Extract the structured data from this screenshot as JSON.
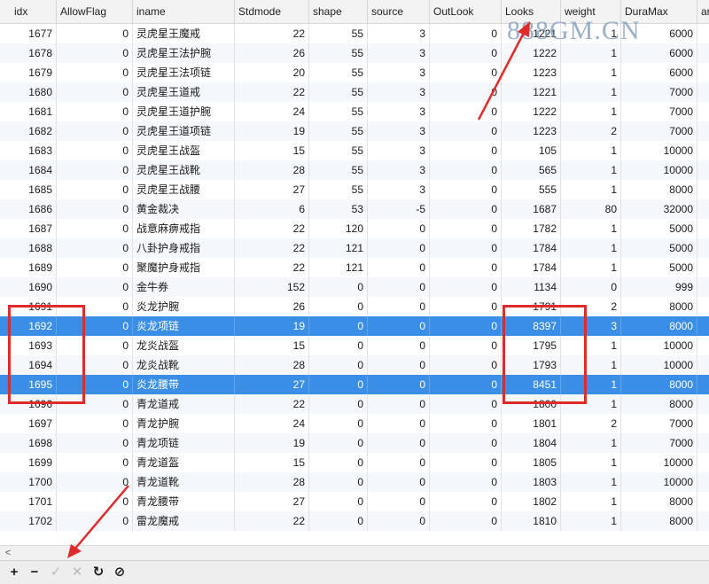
{
  "columns": [
    "idx",
    "AllowFlag",
    "iname",
    "Stdmode",
    "shape",
    "source",
    "OutLook",
    "Looks",
    "weight",
    "DuraMax",
    "ar"
  ],
  "rows": [
    [
      "1677",
      "0",
      "灵虎星王魔戒",
      "22",
      "55",
      "3",
      "0",
      "1221",
      "1",
      "6000"
    ],
    [
      "1678",
      "0",
      "灵虎星王法护腕",
      "26",
      "55",
      "3",
      "0",
      "1222",
      "1",
      "6000"
    ],
    [
      "1679",
      "0",
      "灵虎星王法项链",
      "20",
      "55",
      "3",
      "0",
      "1223",
      "1",
      "6000"
    ],
    [
      "1680",
      "0",
      "灵虎星王道戒",
      "22",
      "55",
      "3",
      "0",
      "1221",
      "1",
      "7000"
    ],
    [
      "1681",
      "0",
      "灵虎星王道护腕",
      "24",
      "55",
      "3",
      "0",
      "1222",
      "1",
      "7000"
    ],
    [
      "1682",
      "0",
      "灵虎星王道项链",
      "19",
      "55",
      "3",
      "0",
      "1223",
      "2",
      "7000"
    ],
    [
      "1683",
      "0",
      "灵虎星王战盔",
      "15",
      "55",
      "3",
      "0",
      "105",
      "1",
      "10000"
    ],
    [
      "1684",
      "0",
      "灵虎星王战靴",
      "28",
      "55",
      "3",
      "0",
      "565",
      "1",
      "10000"
    ],
    [
      "1685",
      "0",
      "灵虎星王战腰",
      "27",
      "55",
      "3",
      "0",
      "555",
      "1",
      "8000"
    ],
    [
      "1686",
      "0",
      "黄金裁决",
      "6",
      "53",
      "-5",
      "0",
      "1687",
      "80",
      "32000"
    ],
    [
      "1687",
      "0",
      "战意麻痹戒指",
      "22",
      "120",
      "0",
      "0",
      "1782",
      "1",
      "5000"
    ],
    [
      "1688",
      "0",
      "八卦护身戒指",
      "22",
      "121",
      "0",
      "0",
      "1784",
      "1",
      "5000"
    ],
    [
      "1689",
      "0",
      "聚魔护身戒指",
      "22",
      "121",
      "0",
      "0",
      "1784",
      "1",
      "5000"
    ],
    [
      "1690",
      "0",
      "金牛券",
      "152",
      "0",
      "0",
      "0",
      "1134",
      "0",
      "999"
    ],
    [
      "1691",
      "0",
      "炎龙护腕",
      "26",
      "0",
      "0",
      "0",
      "1791",
      "2",
      "8000"
    ],
    [
      "1692",
      "0",
      "炎龙项链",
      "19",
      "0",
      "0",
      "0",
      "8397",
      "3",
      "8000"
    ],
    [
      "1693",
      "0",
      "龙炎战盔",
      "15",
      "0",
      "0",
      "0",
      "1795",
      "1",
      "10000"
    ],
    [
      "1694",
      "0",
      "龙炎战靴",
      "28",
      "0",
      "0",
      "0",
      "1793",
      "1",
      "10000"
    ],
    [
      "1695",
      "0",
      "炎龙腰带",
      "27",
      "0",
      "0",
      "0",
      "8451",
      "1",
      "8000"
    ],
    [
      "1696",
      "0",
      "青龙道戒",
      "22",
      "0",
      "0",
      "0",
      "1800",
      "1",
      "8000"
    ],
    [
      "1697",
      "0",
      "青龙护腕",
      "24",
      "0",
      "0",
      "0",
      "1801",
      "2",
      "7000"
    ],
    [
      "1698",
      "0",
      "青龙项链",
      "19",
      "0",
      "0",
      "0",
      "1804",
      "1",
      "7000"
    ],
    [
      "1699",
      "0",
      "青龙道盔",
      "15",
      "0",
      "0",
      "0",
      "1805",
      "1",
      "10000"
    ],
    [
      "1700",
      "0",
      "青龙道靴",
      "28",
      "0",
      "0",
      "0",
      "1803",
      "1",
      "10000"
    ],
    [
      "1701",
      "0",
      "青龙腰带",
      "27",
      "0",
      "0",
      "0",
      "1802",
      "1",
      "8000"
    ],
    [
      "1702",
      "0",
      "雷龙魔戒",
      "22",
      "0",
      "0",
      "0",
      "1810",
      "1",
      "8000"
    ]
  ],
  "selected_rows": [
    "1692",
    "1695"
  ],
  "toolbar": [
    {
      "name": "add-row-icon",
      "glyph": "+",
      "enabled": true
    },
    {
      "name": "delete-row-icon",
      "glyph": "−",
      "enabled": true
    },
    {
      "name": "apply-changes-icon",
      "glyph": "✓",
      "enabled": false
    },
    {
      "name": "discard-changes-icon",
      "glyph": "✕",
      "enabled": false
    },
    {
      "name": "refresh-icon",
      "glyph": "↻",
      "enabled": true
    },
    {
      "name": "stop-icon",
      "glyph": "⊘",
      "enabled": true
    }
  ],
  "scroll_left_glyph": "<",
  "watermark": "888GM.CN",
  "colors": {
    "selected_row": "#3a8ee6",
    "annotation_red": "#e02b2b",
    "alt_row": "#f4f7fb"
  }
}
